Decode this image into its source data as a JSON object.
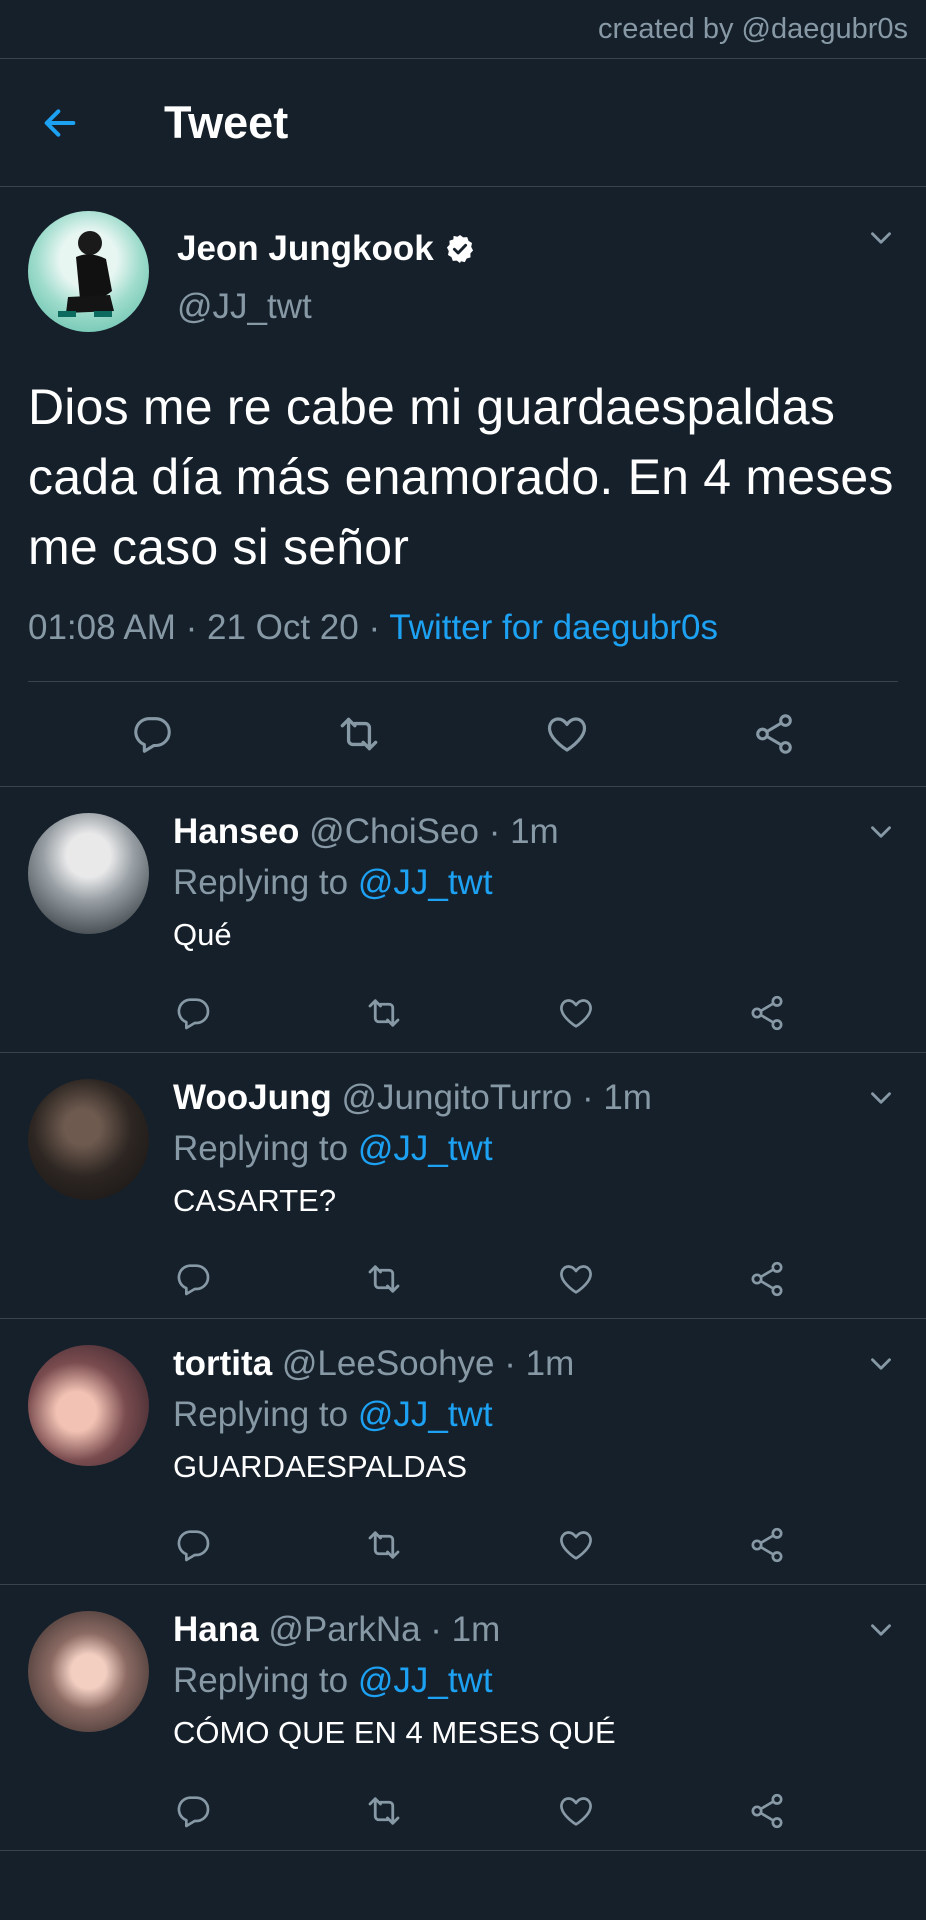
{
  "watermark": "created by @daegubr0s",
  "header": {
    "title": "Tweet"
  },
  "tweet": {
    "name": "Jeon Jungkook",
    "handle": "@JJ_twt",
    "text": "Dios me re cabe mi guardaespaldas cada día más enamorado. En 4 meses me caso si señor",
    "time": "01:08 AM · 21 Oct 20 · ",
    "client": "Twitter for daegubr0s"
  },
  "replies": [
    {
      "name": "Hanseo",
      "handle": "@ChoiSeo",
      "time": " · 1m",
      "replying_label": "Replying to ",
      "replying_to": "@JJ_twt",
      "text": "Qué"
    },
    {
      "name": "WooJung",
      "handle": "@JungitoTurro",
      "time": " · 1m",
      "replying_label": "Replying to ",
      "replying_to": "@JJ_twt",
      "text": "CASARTE?"
    },
    {
      "name": "tortita",
      "handle": "@LeeSoohye",
      "time": " · 1m",
      "replying_label": "Replying to ",
      "replying_to": "@JJ_twt",
      "text": "GUARDAESPALDAS"
    },
    {
      "name": "Hana",
      "handle": "@ParkNa",
      "time": " · 1m",
      "replying_label": "Replying to ",
      "replying_to": "@JJ_twt",
      "text": "CÓMO QUE EN 4 MESES QUÉ"
    }
  ],
  "colors": {
    "background": "#15202b",
    "accent": "#1da1f2",
    "muted": "#8899a6",
    "divider": "#38444d"
  },
  "icons": [
    "back-arrow-icon",
    "verified-badge-icon",
    "chevron-down-icon",
    "reply-icon",
    "retweet-icon",
    "like-icon",
    "share-icon"
  ]
}
